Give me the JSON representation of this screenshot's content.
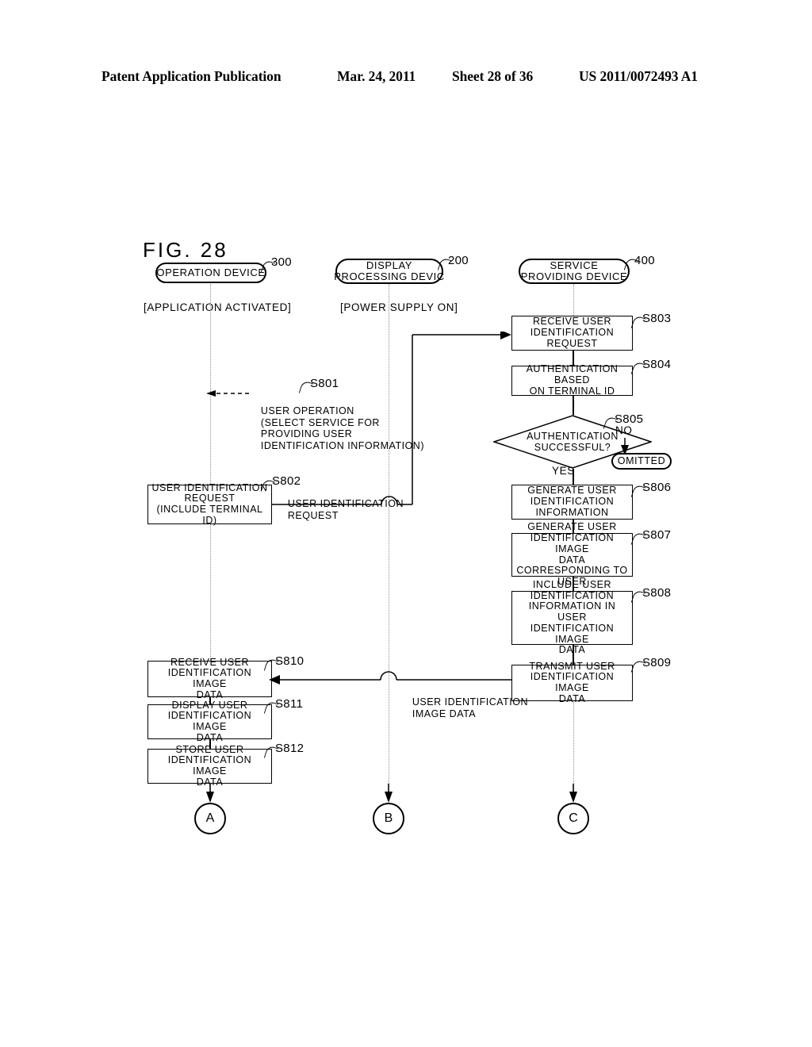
{
  "header": {
    "publication": "Patent Application Publication",
    "date": "Mar. 24, 2011",
    "sheet": "Sheet 28 of 36",
    "number": "US 2011/0072493 A1"
  },
  "figure": {
    "title": "FIG.  28",
    "lanes": [
      {
        "id": "operation",
        "name": "OPERATION DEVICE",
        "ref": "300",
        "state": "[APPLICATION ACTIVATED]"
      },
      {
        "id": "display",
        "name_line1": "DISPLAY",
        "name_line2": "PROCESSING DEVIC",
        "ref": "200",
        "state": "[POWER SUPPLY ON]"
      },
      {
        "id": "service",
        "name_line1": "SERVICE",
        "name_line2": "PROVIDING DEVICE",
        "ref": "400",
        "state": ""
      }
    ],
    "steps": [
      {
        "tag": "S801",
        "lane": "operation",
        "kind": "annotation",
        "lines": [
          "USER OPERATION",
          "(SELECT SERVICE FOR",
          "PROVIDING USER",
          "IDENTIFICATION INFORMATION)"
        ]
      },
      {
        "tag": "S802",
        "lane": "operation",
        "kind": "process",
        "lines": [
          "USER IDENTIFICATION",
          "REQUEST",
          "(INCLUDE TERMINAL ID)"
        ]
      },
      {
        "tag": "S803",
        "lane": "service",
        "kind": "process",
        "lines": [
          "RECEIVE USER",
          "IDENTIFICATION",
          "REQUEST"
        ]
      },
      {
        "tag": "S804",
        "lane": "service",
        "kind": "process",
        "lines": [
          "AUTHENTICATION BASED",
          "ON TERMINAL ID"
        ]
      },
      {
        "tag": "S805",
        "lane": "service",
        "kind": "decision",
        "lines": [
          "AUTHENTICATION",
          "SUCCESSFUL?"
        ],
        "yes_label": "YES",
        "no_label": "NO",
        "no_target": "OMITTED"
      },
      {
        "tag": "S806",
        "lane": "service",
        "kind": "process",
        "lines": [
          "GENERATE USER",
          "IDENTIFICATION",
          "INFORMATION"
        ]
      },
      {
        "tag": "S807",
        "lane": "service",
        "kind": "process",
        "lines": [
          "GENERATE USER",
          "IDENTIFICATION IMAGE",
          "DATA CORRESPONDING TO",
          "USER"
        ]
      },
      {
        "tag": "S808",
        "lane": "service",
        "kind": "process",
        "lines": [
          "INCLUDE USER",
          "IDENTIFICATION",
          "INFORMATION IN USER",
          "IDENTIFICATION IMAGE",
          "DATA"
        ]
      },
      {
        "tag": "S809",
        "lane": "service",
        "kind": "process",
        "lines": [
          "TRANSMIT USER",
          "IDENTIFICATION IMAGE",
          "DATA"
        ]
      },
      {
        "tag": "S810",
        "lane": "operation",
        "kind": "process",
        "lines": [
          "RECEIVE USER",
          "IDENTIFICATION IMAGE",
          "DATA"
        ]
      },
      {
        "tag": "S811",
        "lane": "operation",
        "kind": "process",
        "lines": [
          "DISPLAY USER",
          "IDENTIFICATION IMAGE",
          "DATA"
        ]
      },
      {
        "tag": "S812",
        "lane": "operation",
        "kind": "process",
        "lines": [
          "STORE USER",
          "IDENTIFICATION IMAGE",
          "DATA"
        ]
      }
    ],
    "messages": [
      {
        "id": "request",
        "lines": [
          "USER IDENTIFICATION",
          "REQUEST"
        ],
        "from": "operation",
        "to": "service"
      },
      {
        "id": "image-data",
        "lines": [
          "USER IDENTIFICATION",
          "IMAGE DATA"
        ],
        "from": "service",
        "to": "operation"
      }
    ],
    "connectors": [
      {
        "id": "a",
        "label": "A",
        "lane": "operation"
      },
      {
        "id": "b",
        "label": "B",
        "lane": "display"
      },
      {
        "id": "c",
        "label": "C",
        "lane": "service"
      }
    ]
  }
}
